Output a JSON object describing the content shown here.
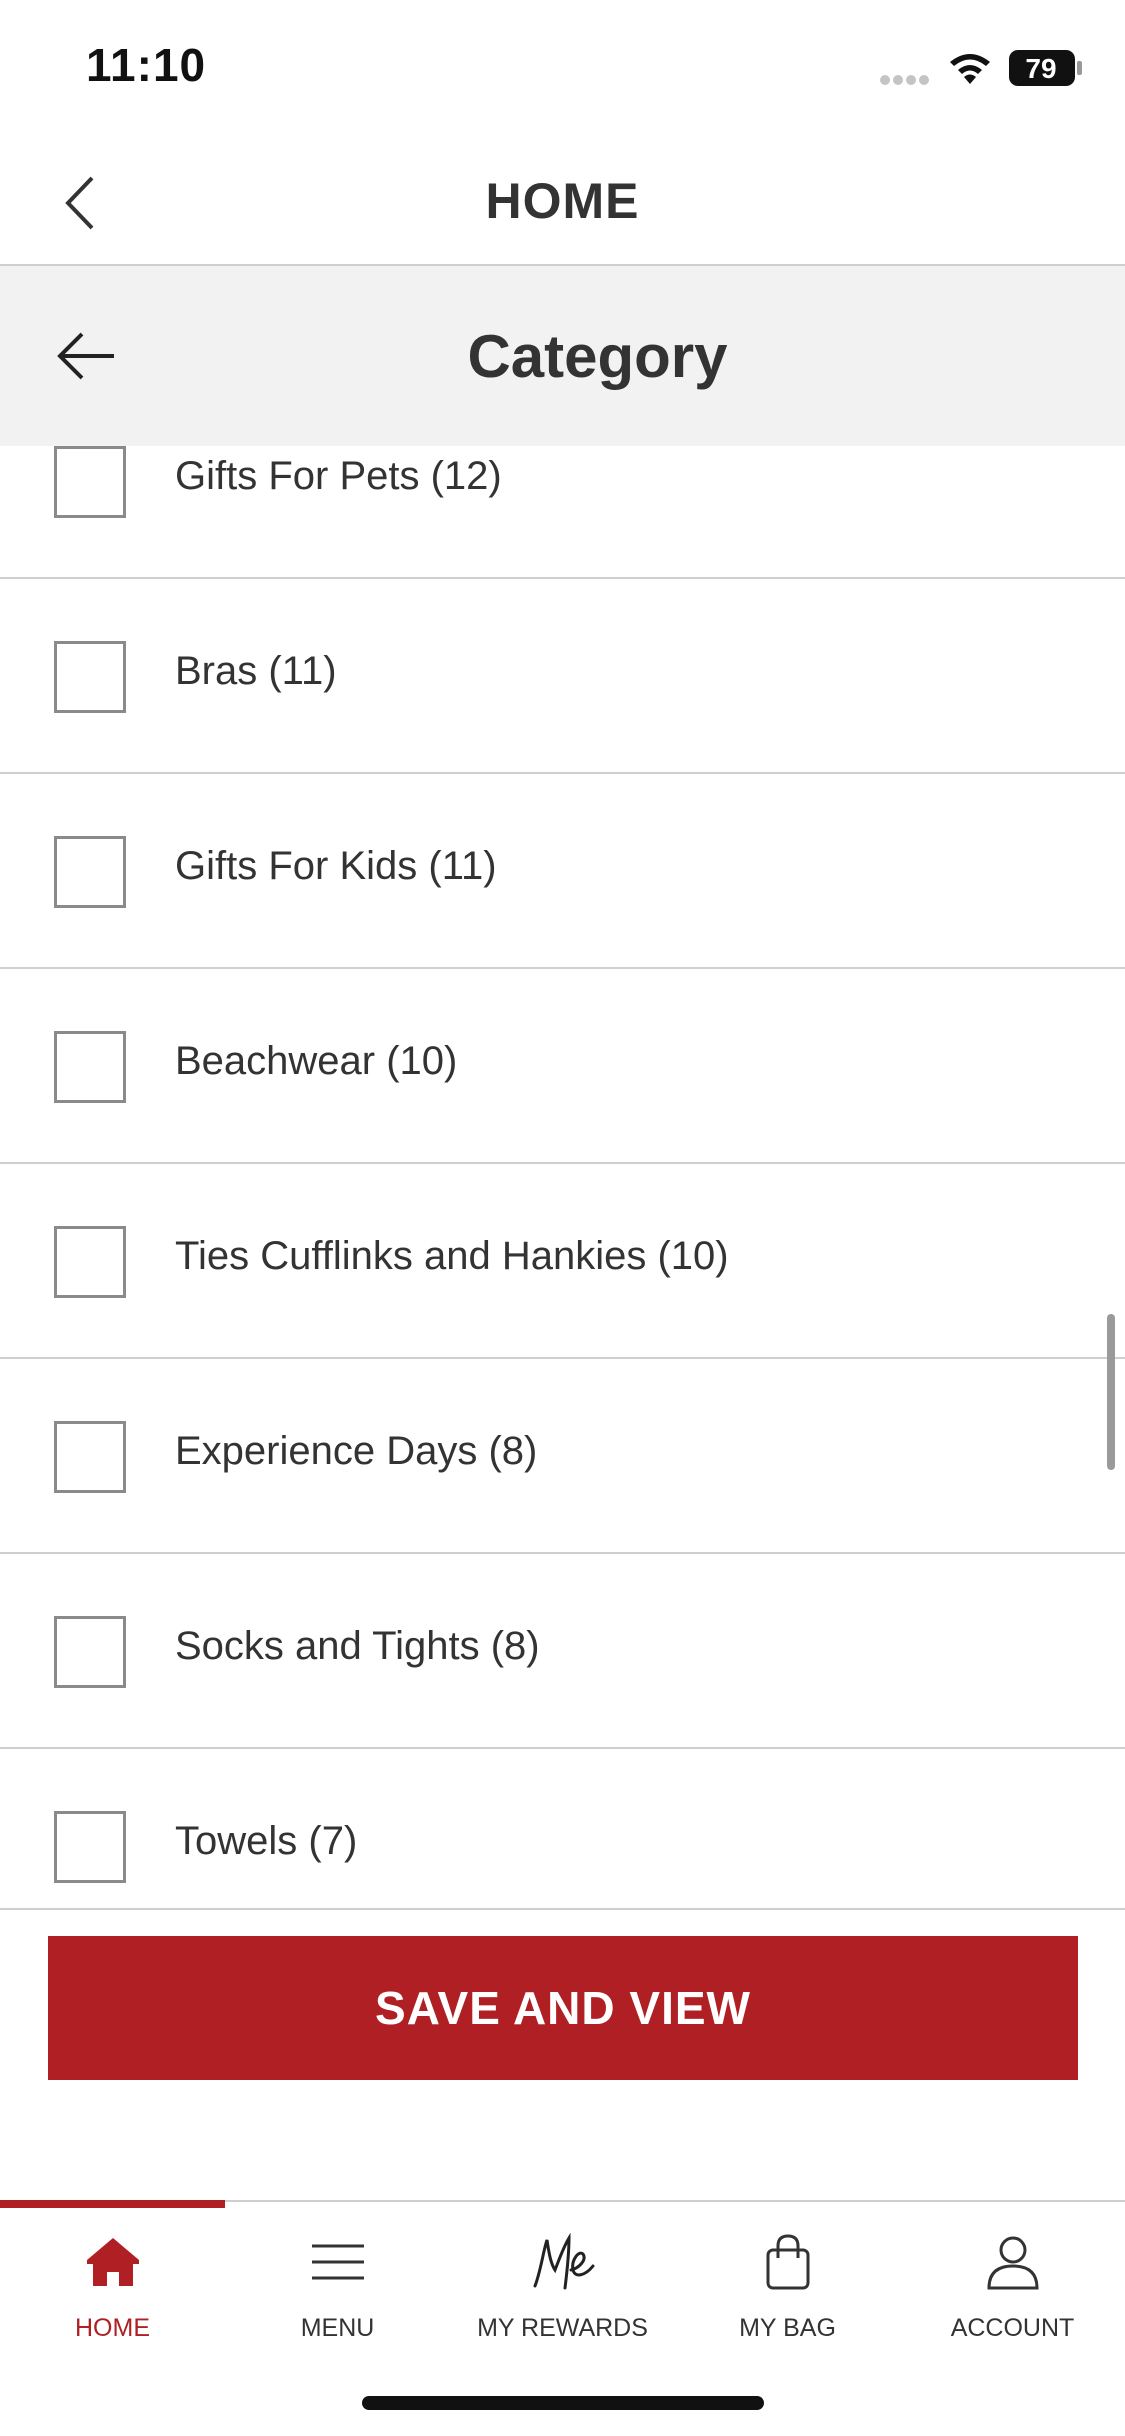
{
  "status_bar": {
    "time": "11:10",
    "battery": "79"
  },
  "header": {
    "title": "HOME"
  },
  "category_bar": {
    "title": "Category"
  },
  "categories": [
    {
      "label": "Gifts For Pets (12)",
      "checked": false
    },
    {
      "label": "Bras (11)",
      "checked": false
    },
    {
      "label": "Gifts For Kids (11)",
      "checked": false
    },
    {
      "label": "Beachwear (10)",
      "checked": false
    },
    {
      "label": "Ties Cufflinks and Hankies (10)",
      "checked": false
    },
    {
      "label": "Experience Days (8)",
      "checked": false
    },
    {
      "label": "Socks and Tights (8)",
      "checked": false
    },
    {
      "label": "Towels (7)",
      "checked": false
    }
  ],
  "save_button": {
    "label": "SAVE AND VIEW"
  },
  "tab_bar": {
    "tabs": [
      {
        "label": "HOME",
        "icon": "home-icon",
        "active": true
      },
      {
        "label": "MENU",
        "icon": "menu-icon",
        "active": false
      },
      {
        "label": "MY REWARDS",
        "icon": "rewards-icon",
        "active": false
      },
      {
        "label": "MY BAG",
        "icon": "bag-icon",
        "active": false
      },
      {
        "label": "ACCOUNT",
        "icon": "account-icon",
        "active": false
      }
    ]
  },
  "colors": {
    "accent": "#b01f24",
    "category_bar_bg": "#f2f2f2",
    "divider": "#cfcfcf"
  }
}
